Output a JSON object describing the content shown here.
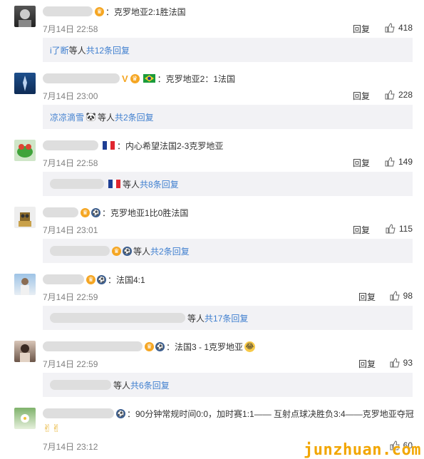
{
  "comments": [
    {
      "text": "：克罗地亚2:1胜法国",
      "time": "7月14日 22:58",
      "reply": "回复",
      "likes": "418",
      "sub": {
        "user": "i了断",
        "mid": " 等人 ",
        "count": "共12条回复"
      }
    },
    {
      "text": "：克罗地亚2：1法国",
      "time": "7月14日 23:00",
      "reply": "回复",
      "likes": "228",
      "sub": {
        "user": "凉凉滴雪",
        "mid": " 等人 ",
        "count": "共2条回复"
      }
    },
    {
      "text": "：内心希望法国2-3克罗地亚",
      "time": "7月14日 22:58",
      "reply": "回复",
      "likes": "149",
      "sub": {
        "user": "",
        "mid": " 等人 ",
        "count": "共8条回复"
      }
    },
    {
      "text": "：克罗地亚1比0胜法国",
      "time": "7月14日 23:01",
      "reply": "回复",
      "likes": "115",
      "sub": {
        "user": "",
        "mid": " 等人 ",
        "count": "共2条回复"
      }
    },
    {
      "text": "：法国4:1",
      "time": "7月14日 22:59",
      "reply": "回复",
      "likes": "98",
      "sub": {
        "user": "",
        "mid": " 等人 ",
        "count": "共17条回复"
      }
    },
    {
      "text": "：法国3 - 1克罗地亚",
      "time": "7月14日 22:59",
      "reply": "回复",
      "likes": "93",
      "sub": {
        "user": "",
        "mid": "等人 ",
        "count": "共6条回复"
      }
    },
    {
      "text": "：90分钟常规时间0:0，加时赛1:1—— 互射点球决胜负3:4——克罗地亚夺冠",
      "time": "7月14日 23:12",
      "reply": "",
      "likes": "60"
    }
  ],
  "watermark": "junzhuan.com",
  "colors": {
    "link": "#eb7350",
    "accent": "#3f7fcf",
    "subbox": "#f2f2f5"
  }
}
